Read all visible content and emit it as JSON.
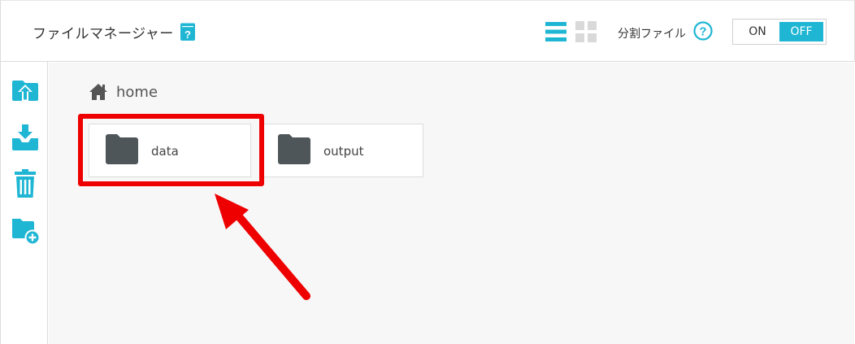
{
  "header": {
    "title": "ファイルマネージャー",
    "title_help_icon": "book-question-icon",
    "view_modes": [
      "list-view-icon",
      "grid-view-icon"
    ],
    "active_view": "list",
    "split_label": "分割ファイル",
    "split_help_icon": "help-circle-icon",
    "toggle": {
      "on_label": "ON",
      "off_label": "OFF",
      "selected": "OFF"
    }
  },
  "sidebar": {
    "items": [
      {
        "icon": "upload-folder-icon"
      },
      {
        "icon": "download-tray-icon"
      },
      {
        "icon": "trash-icon"
      },
      {
        "icon": "new-folder-icon"
      }
    ]
  },
  "breadcrumb": {
    "icon": "home-icon",
    "label": "home"
  },
  "folders": [
    {
      "name": "data",
      "icon": "folder-icon",
      "highlighted": true
    },
    {
      "name": "output",
      "icon": "folder-icon",
      "highlighted": false
    }
  ],
  "colors": {
    "accent": "#1fb6d4",
    "folder": "#4f5659",
    "annotation": "#ee0000",
    "icon_inactive": "#d9d9d9"
  }
}
